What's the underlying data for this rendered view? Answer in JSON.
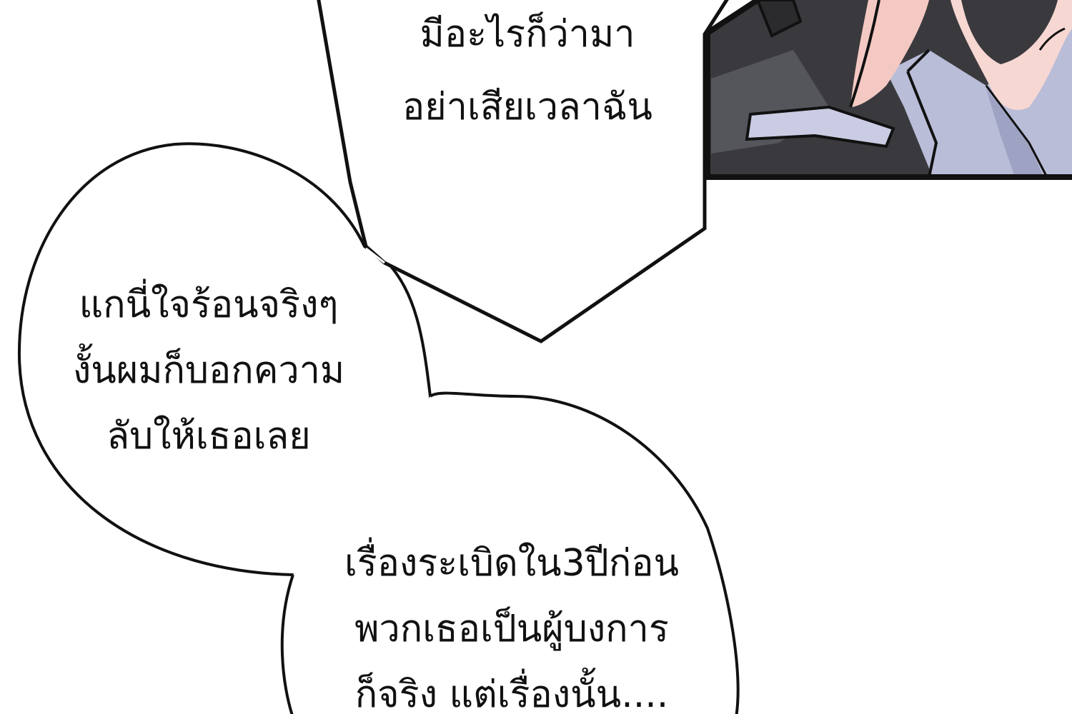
{
  "bubbles": {
    "top": {
      "lines": [
        "มีอะไรก็ว่ามา",
        "อย่าเสียเวลาฉัน"
      ]
    },
    "left": {
      "lines": [
        "แกนี่ใจร้อนจริงๆ",
        "งั้นผมก็บอกความ",
        "ลับให้เธอเลย"
      ]
    },
    "bottom": {
      "lines": [
        "เรื่องระเบิดใน3ปีก่อน",
        "พวกเธอเป็นผู้บงการ",
        "ก็จริง แต่เรื่องนั้น...."
      ]
    }
  },
  "colors": {
    "ink": "#111111",
    "paper": "#ffffff",
    "suit": "#3a3a3e",
    "shirt": "#b9bdd8",
    "skin": "#f7d7d2"
  }
}
